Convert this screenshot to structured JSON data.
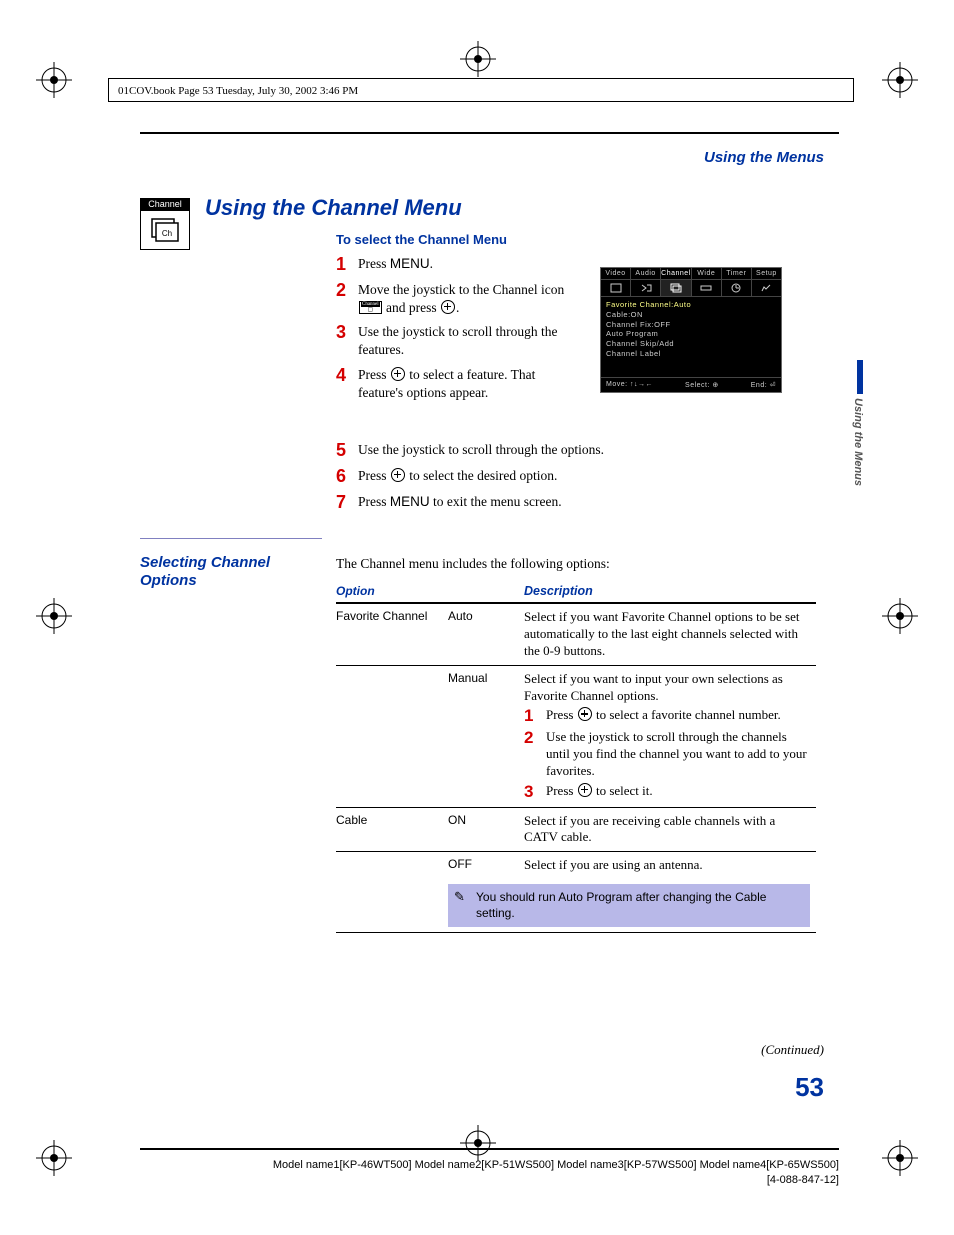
{
  "header_line": "01COV.book  Page 53  Tuesday, July 30, 2002  3:46 PM",
  "breadcrumb": "Using the Menus",
  "section_title": "Using the Channel Menu",
  "channel_badge_label": "Channel",
  "side_tab": "Using the Menus",
  "select_heading": "To select the Channel Menu",
  "steps": {
    "s1": "Press MENU.",
    "s2a": "Move the joystick to the Channel icon ",
    "s2b": " and press ",
    "s2c": ".",
    "s3": "Use the joystick to scroll through the features.",
    "s4a": "Press ",
    "s4b": " to select a feature. That feature's options appear.",
    "s5": "Use the joystick to scroll through the options.",
    "s6a": "Press ",
    "s6b": " to select the desired option.",
    "s7": "Press MENU to exit the menu screen."
  },
  "osd": {
    "tabs": [
      "Video",
      "Audio",
      "Channel",
      "Wide",
      "Timer",
      "Setup"
    ],
    "list": [
      "Favorite Channel:Auto",
      "Cable:ON",
      "Channel Fix:OFF",
      "Auto Program",
      "Channel Skip/Add",
      "Channel Label"
    ],
    "foot_move": "Move:",
    "foot_select": "Select:",
    "foot_end": "End:"
  },
  "left_subhead": "Selecting Channel Options",
  "intro": "The Channel menu includes the following options:",
  "table": {
    "h1": "Option",
    "h2": "Description",
    "rows": {
      "fav": {
        "option": "Favorite Channel",
        "auto_label": "Auto",
        "auto_desc": "Select if you want Favorite Channel options to be set automatically to the last eight channels selected with the 0-9 buttons.",
        "manual_label": "Manual",
        "manual_desc": "Select if you want to input your own selections as Favorite Channel options.",
        "m1a": "Press ",
        "m1b": " to select a favorite channel number.",
        "m2": "Use the joystick to scroll through the channels until you find the channel you want to add to your favorites.",
        "m3a": "Press ",
        "m3b": " to select it."
      },
      "cable": {
        "option": "Cable",
        "on_label": "ON",
        "on_desc": "Select if you are receiving cable channels with a CATV cable.",
        "off_label": "OFF",
        "off_desc": "Select if you are using an antenna.",
        "note": "You should run Auto Program after changing the Cable setting."
      }
    }
  },
  "continued": "(Continued)",
  "page_number": "53",
  "footer_line1": "Model name1[KP-46WT500] Model name2[KP-51WS500] Model name3[KP-57WS500] Model name4[KP-65WS500]",
  "footer_line2": "[4-088-847-12]"
}
